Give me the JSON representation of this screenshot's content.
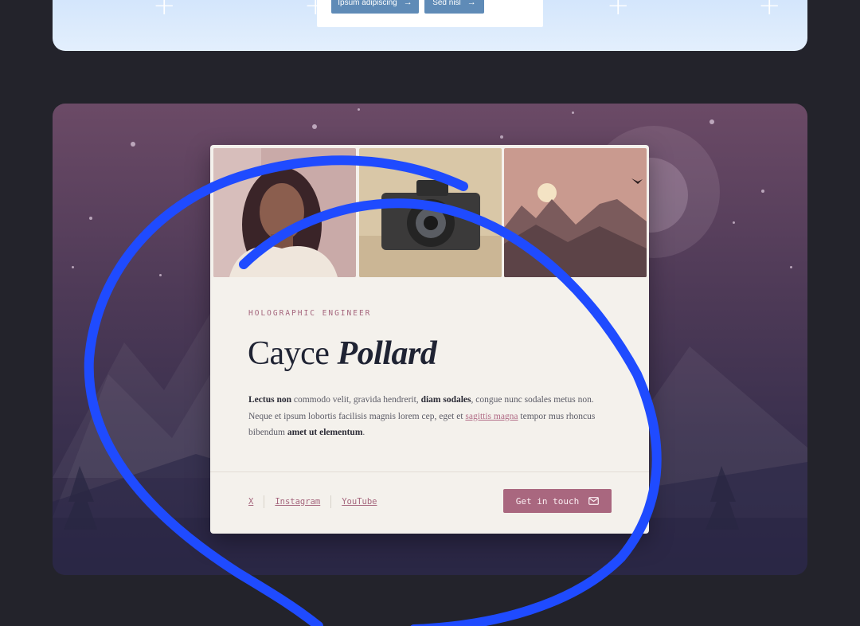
{
  "top_section": {
    "buttons": [
      {
        "label": "Ipsum adipiscing",
        "arrow": "→"
      },
      {
        "label": "Sed nisl",
        "arrow": "→"
      }
    ]
  },
  "profile": {
    "eyebrow": "HOLOGRAPHIC ENGINEER",
    "first_name": "Cayce",
    "last_name": "Pollard",
    "bio": {
      "b1": "Lectus non",
      "t1": " commodo velit, gravida hendrerit, ",
      "b2": "diam sodales",
      "t2": ", congue nunc sodales metus non. Neque et ipsum lobortis facilisis magnis lorem cep, eget et ",
      "link": "sagittis magna",
      "t3": " tempor mus rhoncus bibendum ",
      "b3": "amet ut elementum",
      "t4": "."
    },
    "socials": [
      "X",
      "Instagram",
      "YouTube"
    ],
    "cta_label": "Get in touch"
  },
  "icons": {
    "arrow": "arrow-right-icon",
    "mail": "mail-icon",
    "plus": "plus-icon"
  },
  "colors": {
    "accent": "#a9677f",
    "ink": "#1f2333",
    "scribble": "#1f4bff",
    "top_button": "#5f8bb7"
  }
}
